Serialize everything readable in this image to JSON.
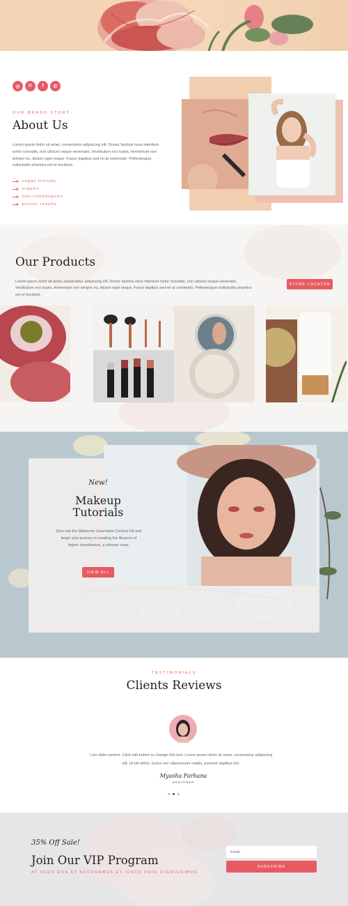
{
  "colors": {
    "accent": "#e85a62",
    "heading": "#222222",
    "body_text": "#666666"
  },
  "about": {
    "social": [
      {
        "name": "instagram-icon",
        "glyph": "◎"
      },
      {
        "name": "pinterest-icon",
        "glyph": "℗"
      },
      {
        "name": "facebook-icon",
        "glyph": "f"
      },
      {
        "name": "whatsapp-icon",
        "glyph": "✆"
      }
    ],
    "eyebrow": "OUR BRAND STORY",
    "title": "About Us",
    "body": "Lorem ipsum dolor sit amet, consectetur adipiscing elit. Donec facilisis risus interdum tortor convallis, non ultrices neque venenatis. Vestibulum orci turpis, fermentum non tempor eu, dictum eget neque. Fusce dapibus sed mi at commodo. Pellentesque sollicitudin pharetra est et tincidunt.",
    "features": [
      "vegan friendly",
      "organic",
      "non-comedogenic",
      "proven results"
    ]
  },
  "products": {
    "title": "Our Products",
    "body": "Lorem ipsum dolor sit amet, consectetur adipiscing elit. Donec facilisis risus interdum tortor convallis, non ultrices neque venenatis. Vestibulum orci turpis, fermentum non tempor eu, dictum eget neque. Fusce dapibus sed mi at commodo. Pellentesque sollicitudin pharetra est et tincidunt.",
    "button": "STORE LOCATOR"
  },
  "tutorials": {
    "tag": "New!",
    "title_line1": "Makeup",
    "title_line2": "Tutorials",
    "body": "Dive into the Makeover Essentials Contour Kit and begin your journey in creating the illusions of higher cheekbones, a slimmer nose.",
    "button": "VIEW ALL"
  },
  "testimonials": {
    "eyebrow": "TESTIMONIALS",
    "title": "Clients Reviews",
    "quote": "I am slide content. Click edit button to change this text. Lorem ipsum dolor sit amet, consectetur adipiscing elit. Ut elit tellus, luctus nec ullamcorper mattis, pulvinar dapibus leo.",
    "name": "Myasha Farhana",
    "role": "DESIGNER",
    "active_dot": 1
  },
  "vip": {
    "tag": "35% Off Sale!",
    "title": "Join Our VIP Program",
    "subtitle": "AT VERO EOS ET ACCUSAMUS ET IUSTO ODIO DIGNISSIMOS.",
    "email_placeholder": "Email",
    "button": "SUBSCRIBE"
  }
}
